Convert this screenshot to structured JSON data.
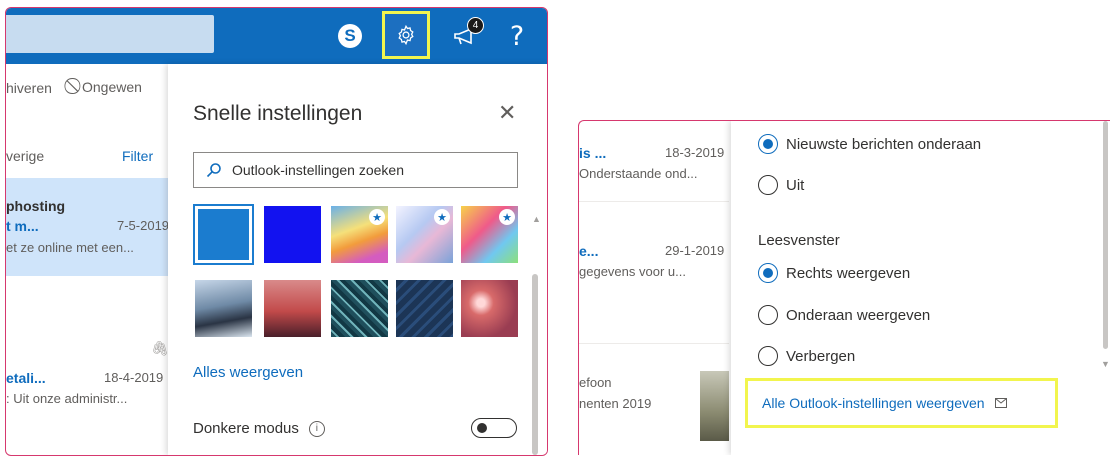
{
  "left": {
    "header": {
      "badge_count": "4",
      "help": "?"
    },
    "commands": {
      "archive": "hiveren",
      "junk": "Ongewen"
    },
    "list": {
      "other_tab": "verige",
      "filter": "Filter",
      "mail1": {
        "sender": "phosting",
        "subject": "t m...",
        "date": "7-5-2019",
        "preview": "et ze online met een..."
      },
      "mail2": {
        "subject": "etali...",
        "date": "18-4-2019",
        "preview": ": Uit onze administr..."
      }
    },
    "quick_settings": {
      "title": "Snelle instellingen",
      "search_placeholder": "Outlook-instellingen zoeken",
      "show_all": "Alles weergeven",
      "dark_mode": "Donkere modus",
      "themes": [
        {
          "name": "theme-blue-selected"
        },
        {
          "name": "theme-bright-blue"
        },
        {
          "name": "theme-rainbow-waves",
          "starred": true
        },
        {
          "name": "theme-light-streaks",
          "starred": true
        },
        {
          "name": "theme-unicorn",
          "starred": true
        },
        {
          "name": "theme-mountains"
        },
        {
          "name": "theme-palm-sunset"
        },
        {
          "name": "theme-circuit"
        },
        {
          "name": "theme-aviation"
        },
        {
          "name": "theme-bokeh"
        }
      ]
    }
  },
  "right": {
    "list": {
      "mail1": {
        "subject": "is ...",
        "date": "18-3-2019",
        "preview": "Onderstaande ond..."
      },
      "mail2": {
        "subject": "e...",
        "date": "29-1-2019",
        "preview": "gegevens voor u..."
      },
      "mail3": {
        "line1": "efoon",
        "line2": "nenten 2019"
      }
    },
    "settings": {
      "newest_bottom": "Nieuwste berichten onderaan",
      "off": "Uit",
      "reading_pane": "Leesvenster",
      "show_right": "Rechts weergeven",
      "show_bottom": "Onderaan weergeven",
      "hide": "Verbergen",
      "all_settings": "Alle Outlook-instellingen weergeven"
    }
  }
}
